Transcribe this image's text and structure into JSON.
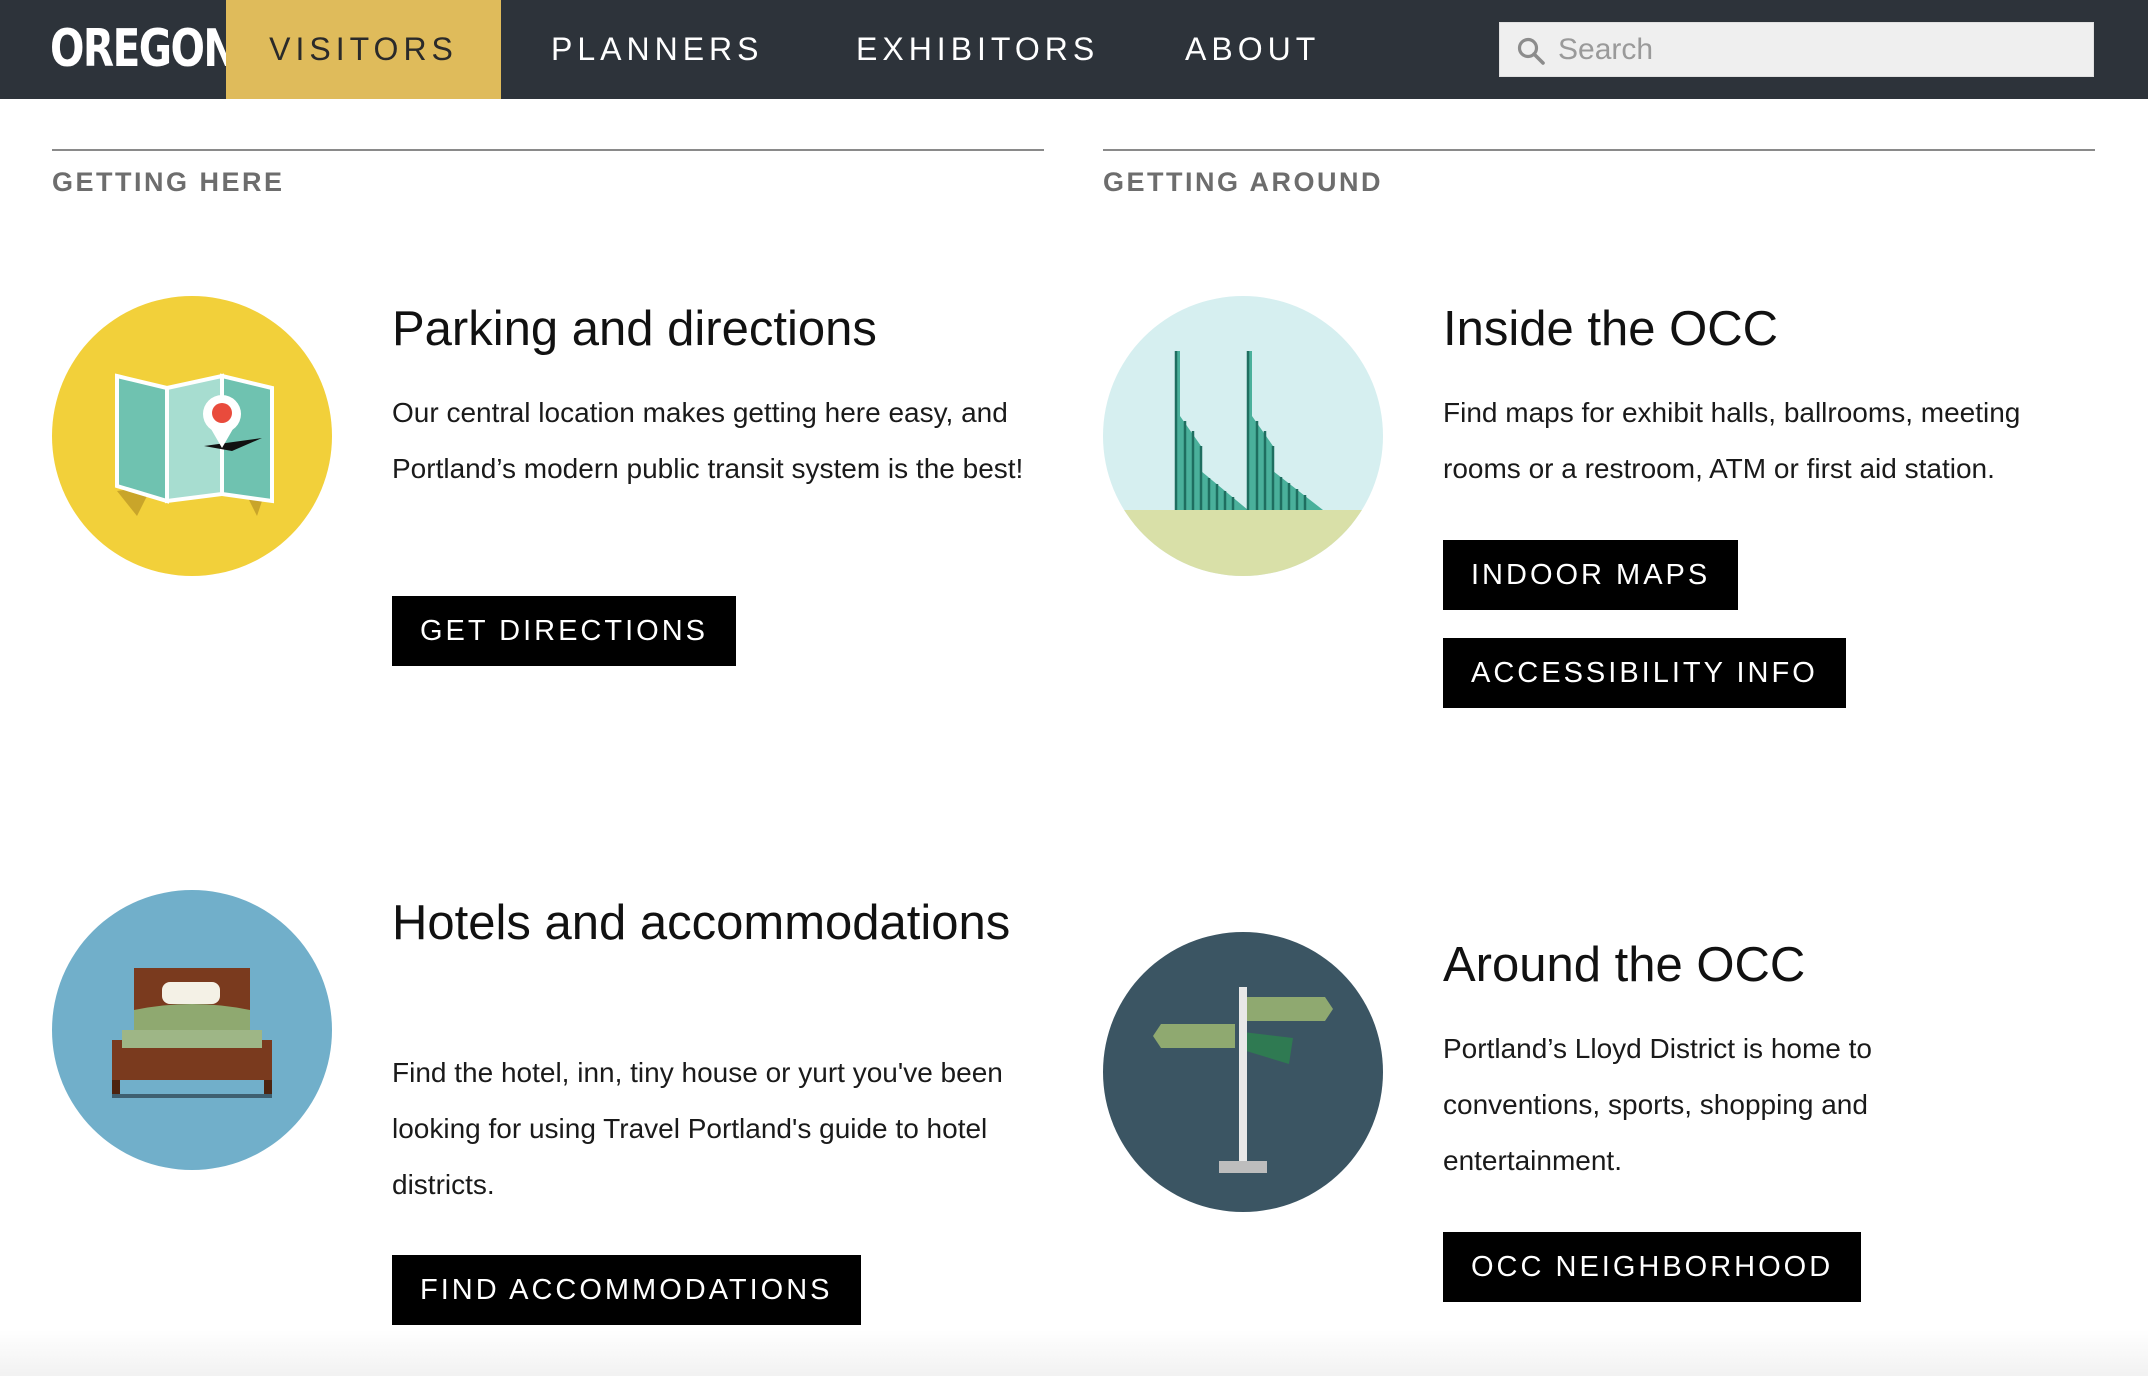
{
  "nav": {
    "logo_text": "OREGON",
    "items": [
      {
        "label": "VISITORS",
        "active": true
      },
      {
        "label": "PLANNERS",
        "active": false
      },
      {
        "label": "EXHIBITORS",
        "active": false
      },
      {
        "label": "ABOUT",
        "active": false
      }
    ],
    "search_placeholder": "Search",
    "colors": {
      "bar": "#2d333a",
      "active": "#dfbb5b"
    }
  },
  "sections": {
    "getting_here": {
      "title": "GETTING HERE"
    },
    "getting_around": {
      "title": "GETTING AROUND"
    }
  },
  "cards": {
    "parking": {
      "icon": "map-pin-icon",
      "title": "Parking and directions",
      "text": "Our central location makes getting here easy, and Portland’s modern public transit system is the best!",
      "buttons": [
        "GET DIRECTIONS"
      ]
    },
    "inside": {
      "icon": "convention-center-towers-icon",
      "title": "Inside the OCC",
      "text": "Find maps for exhibit halls, ballrooms, meeting rooms or a restroom, ATM or first aid station.",
      "buttons": [
        "INDOOR MAPS",
        "ACCESSIBILITY INFO"
      ]
    },
    "hotels": {
      "icon": "bed-icon",
      "title": "Hotels and accommodations",
      "text": "Find the hotel, inn, tiny house or yurt you've been looking for using Travel Portland's guide to hotel districts.",
      "buttons": [
        "FIND ACCOMMODATIONS"
      ]
    },
    "around": {
      "icon": "signpost-icon",
      "title": "Around the OCC",
      "text": "Portland’s Lloyd District is home to conventions, sports, shopping and entertainment.",
      "buttons": [
        "OCC NEIGHBORHOOD"
      ]
    }
  }
}
